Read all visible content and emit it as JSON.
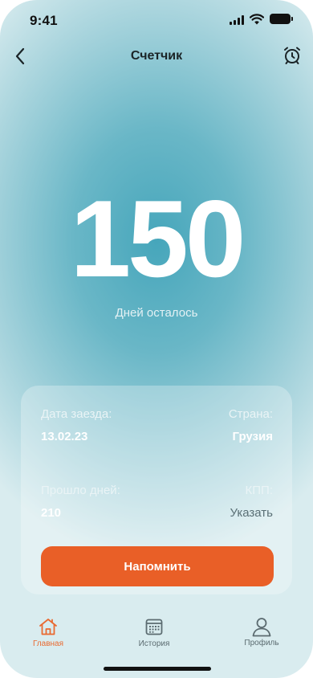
{
  "status_bar": {
    "time": "9:41"
  },
  "nav": {
    "title": "Счетчик",
    "back_icon": "chevron-left-icon",
    "alarm_icon": "alarm-clock-icon"
  },
  "counter": {
    "value": "150",
    "caption": "Дней осталось"
  },
  "card": {
    "entry_date_label": "Дата заезда:",
    "entry_date_value": "13.02.23",
    "country_label": "Страна:",
    "country_value": "Грузия",
    "days_passed_label": "Прошло дней:",
    "days_passed_value": "210",
    "checkpoint_label": "КПП:",
    "checkpoint_action": "Указать",
    "remind_button": "Напомнить"
  },
  "tabs": [
    {
      "label": "Главная",
      "icon": "home-icon",
      "active": true
    },
    {
      "label": "История",
      "icon": "calendar-icon",
      "active": false
    },
    {
      "label": "Профиль",
      "icon": "profile-icon",
      "active": false
    }
  ],
  "colors": {
    "accent": "#e95f27",
    "active_tab": "#e96a31",
    "background": "#46a6bb"
  }
}
